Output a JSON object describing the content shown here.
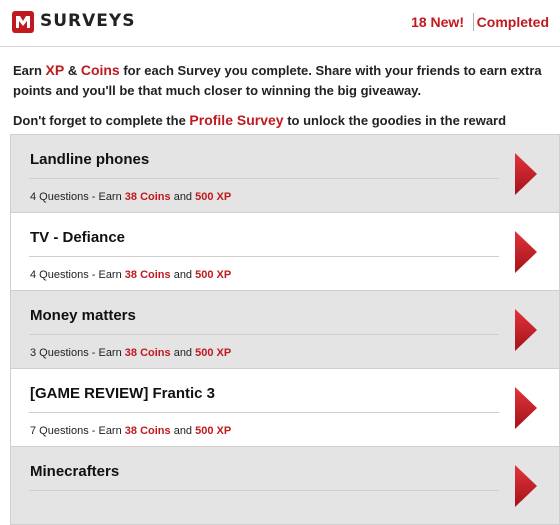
{
  "header": {
    "logo_icon": "surveys-logo-icon",
    "title": "SURVEYS",
    "new_count": "18 New!",
    "completed_label": "Completed",
    "accent_color": "#c0191f"
  },
  "intro": {
    "line1_prefix": "Earn ",
    "xp": "XP",
    "amp": " & ",
    "coins": "Coins",
    "line1_suffix": " for each Survey you complete. Share with your friends to earn extra points and you'll be that much closer to winning the big giveaway.",
    "line2_prefix": "Don't forget to complete the ",
    "profile_survey": "Profile Survey",
    "line2_suffix": " to unlock the goodies in the reward center."
  },
  "surveys": [
    {
      "title": "Landline phones",
      "questions": "4 Questions - Earn ",
      "coins": "38 Coins",
      "and": " and ",
      "xp": "500 XP"
    },
    {
      "title": "TV - Defiance",
      "questions": "4 Questions - Earn ",
      "coins": "38 Coins",
      "and": " and ",
      "xp": "500 XP"
    },
    {
      "title": "Money matters",
      "questions": "3 Questions - Earn ",
      "coins": "38 Coins",
      "and": " and ",
      "xp": "500 XP"
    },
    {
      "title": "[GAME REVIEW] Frantic 3",
      "questions": "7 Questions - Earn ",
      "coins": "38 Coins",
      "and": " and ",
      "xp": "500 XP"
    },
    {
      "title": "Minecrafters",
      "questions": "",
      "coins": "",
      "and": "",
      "xp": ""
    }
  ],
  "arrow_icon": "chevron-right-icon"
}
